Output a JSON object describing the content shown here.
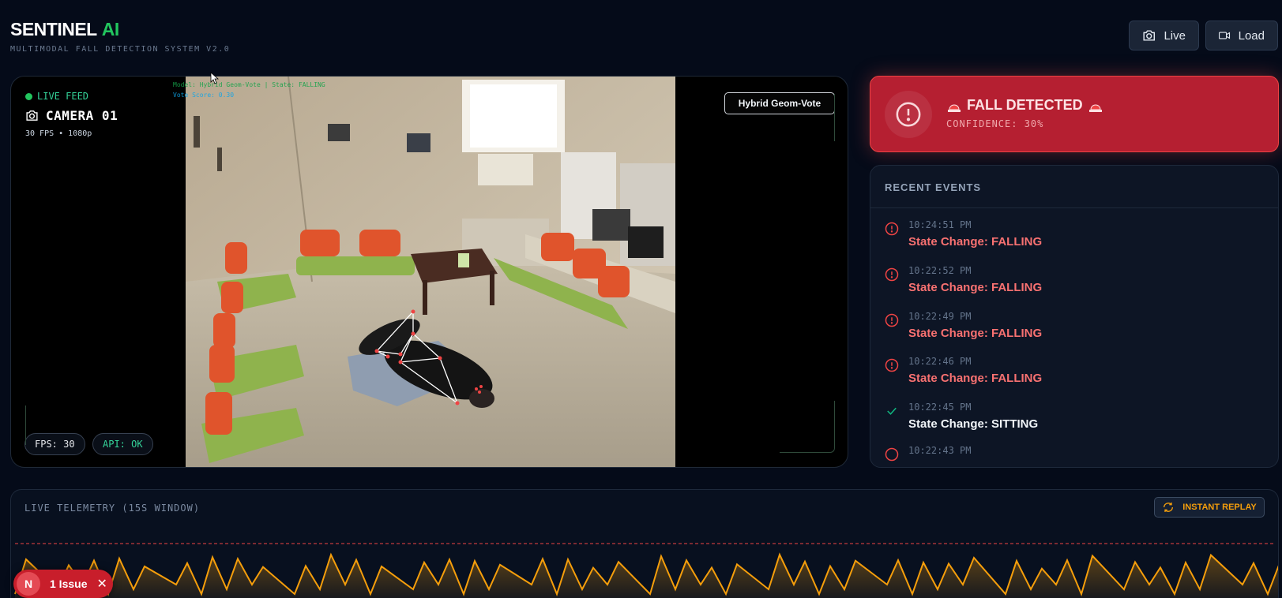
{
  "header": {
    "brand_main": "SENTINEL",
    "brand_accent": "AI",
    "subtitle": "MULTIMODAL FALL DETECTION SYSTEM V2.0",
    "live_button": "Live",
    "load_button": "Load"
  },
  "video": {
    "live_label": "LIVE FEED",
    "camera_name": "CAMERA 01",
    "camera_meta": "30 FPS • 1080p",
    "overlay_model": "Model: Hybrid Geom-Vote | State: FALLING",
    "overlay_vote": "Vote Score: 0.30",
    "model_badge": "Hybrid Geom-Vote",
    "fps_pill": "FPS: 30",
    "api_pill": "API: OK"
  },
  "alert": {
    "title": "FALL DETECTED",
    "confidence": "CONFIDENCE: 30%",
    "color": "#b51f31"
  },
  "events": {
    "heading": "RECENT EVENTS",
    "items": [
      {
        "time": "10:24:51 PM",
        "label": "State Change: FALLING",
        "icon": "alert-circle-icon"
      },
      {
        "time": "10:22:52 PM",
        "label": "State Change: FALLING",
        "icon": "alert-circle-icon"
      },
      {
        "time": "10:22:49 PM",
        "label": "State Change: FALLING",
        "icon": "alert-circle-icon"
      },
      {
        "time": "10:22:46 PM",
        "label": "State Change: FALLING",
        "icon": "alert-circle-icon"
      },
      {
        "time": "10:22:45 PM",
        "label": "State Change: SITTING",
        "icon": "check-icon"
      },
      {
        "time": "10:22:43 PM",
        "label": "",
        "icon": "alert-circle-icon"
      }
    ]
  },
  "telemetry": {
    "title": "LIVE TELEMETRY (15S WINDOW)",
    "replay_button": "INSTANT REPLAY",
    "line_color": "#f59e0b",
    "threshold_color": "#ef4444"
  },
  "issue_badge": {
    "initial": "N",
    "label": "1 Issue"
  }
}
